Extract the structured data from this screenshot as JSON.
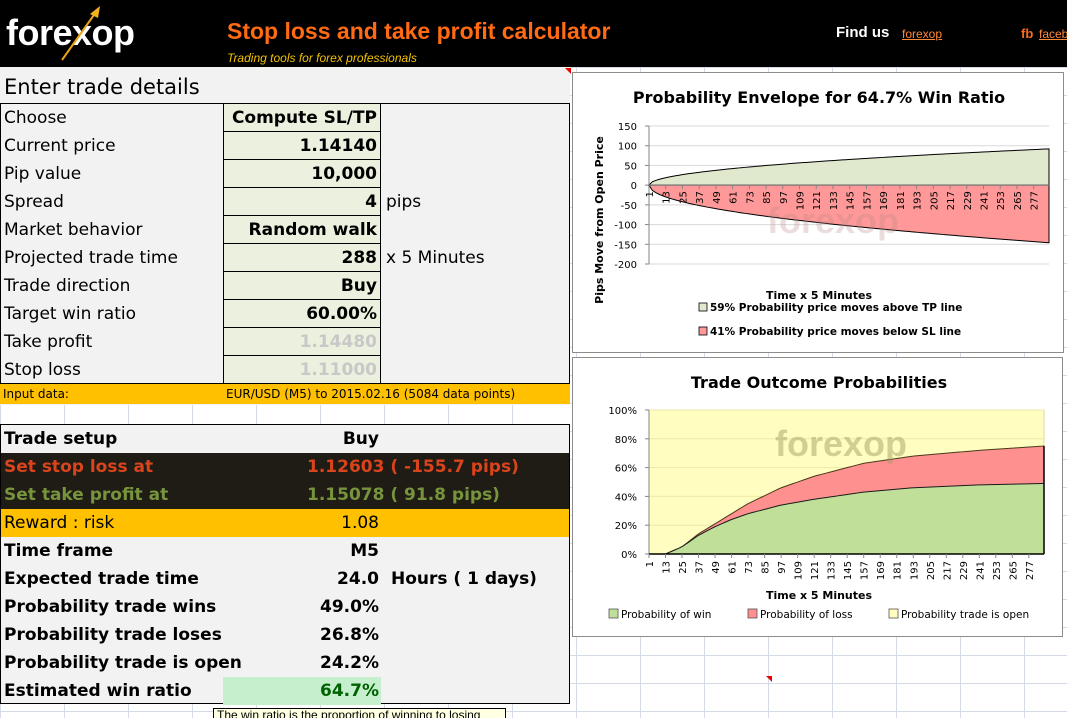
{
  "header": {
    "logo": "forexop",
    "title": "Stop loss and take profit calculator",
    "subtitle": "Trading tools for forex professionals",
    "find_us_label": "Find us",
    "find_us_link": "forexop",
    "fb_label": "fb",
    "fb_link": "facebook"
  },
  "inputs": {
    "section_title": "Enter trade details",
    "rows": [
      {
        "label": "Choose",
        "value": "Compute SL/TP",
        "unit": ""
      },
      {
        "label": "Current price",
        "value": "1.14140",
        "unit": ""
      },
      {
        "label": "Pip value",
        "value": "10,000",
        "unit": ""
      },
      {
        "label": "Spread",
        "value": "4",
        "unit": "pips"
      },
      {
        "label": "Market behavior",
        "value": "Random walk",
        "unit": ""
      },
      {
        "label": "Projected trade time",
        "value": "288",
        "unit": "x 5 Minutes"
      },
      {
        "label": "Trade direction",
        "value": "Buy",
        "unit": ""
      },
      {
        "label": "Target win ratio",
        "value": "60.00%",
        "unit": ""
      },
      {
        "label": "Take profit",
        "value": "1.14480",
        "unit": "",
        "disabled": true
      },
      {
        "label": "Stop loss",
        "value": "1.11000",
        "unit": "",
        "disabled": true
      }
    ],
    "input_data_label": "Input data:",
    "input_data_value": "EUR/USD (M5) to 2015.02.16  (5084 data points)"
  },
  "results": {
    "trade_setup": {
      "label": "Trade setup",
      "value": "Buy"
    },
    "stop_loss": {
      "label": "Set stop loss at",
      "value": "1.12603 ( -155.7 pips)"
    },
    "take_profit": {
      "label": "Set take profit at",
      "value": "1.15078 ( 91.8 pips)"
    },
    "reward_risk": {
      "label": "Reward : risk",
      "value": "1.08"
    },
    "time_frame": {
      "label": "Time frame",
      "value": "M5"
    },
    "expected_time": {
      "label": "Expected trade time",
      "value": "24.0",
      "unit": "Hours ( 1 days)"
    },
    "prob_win": {
      "label": "Probability trade wins",
      "value": "49.0%"
    },
    "prob_lose": {
      "label": "Probability trade loses",
      "value": "26.8%"
    },
    "prob_open": {
      "label": "Probability trade is open",
      "value": "24.2%"
    },
    "win_ratio": {
      "label": "Estimated win ratio",
      "value": "64.7%"
    }
  },
  "tooltip": "The win ratio is the proportion of winning to losing",
  "colors": {
    "brand_orange": "#ff6a13",
    "input_fill": "#ebf1de",
    "gold": "#ffc000",
    "dark_row": "#1f1c16",
    "sl_red": "#d9441c",
    "tp_green": "#77933c",
    "win_fill": "#c6efce",
    "win_text": "#006100"
  },
  "chart_data": [
    {
      "type": "area",
      "title": "Probability Envelope for 64.7% Win Ratio",
      "xlabel": "Time x 5 Minutes",
      "ylabel": "Pips Move from Open Price",
      "ylim": [
        -200,
        150
      ],
      "yticks": [
        150,
        100,
        50,
        0,
        -50,
        -100,
        -150,
        -200
      ],
      "x_range": [
        1,
        288
      ],
      "xtick_labels": [
        "1",
        "13",
        "25",
        "37",
        "49",
        "61",
        "73",
        "85",
        "97",
        "109",
        "121",
        "133",
        "145",
        "157",
        "169",
        "181",
        "193",
        "205",
        "217",
        "229",
        "241",
        "253",
        "265",
        "277"
      ],
      "grid": true,
      "legend_position": "bottom",
      "watermark": "forexop",
      "series": [
        {
          "name": "59% Probability price moves above TP line",
          "color": "#e0e9cd",
          "x": [
            1,
            13,
            25,
            49,
            97,
            145,
            193,
            241,
            288
          ],
          "values": [
            0,
            19,
            27,
            38,
            54,
            65,
            75,
            84,
            92
          ]
        },
        {
          "name": "41% Probability price moves below SL line",
          "color": "#ff9999",
          "x": [
            1,
            13,
            25,
            49,
            97,
            145,
            193,
            241,
            288
          ],
          "values": [
            0,
            -31,
            -44,
            -61,
            -87,
            -106,
            -122,
            -134,
            -146
          ]
        }
      ]
    },
    {
      "type": "area",
      "title": "Trade Outcome Probabilities",
      "xlabel": "Time x 5 Minutes",
      "ylabel": "",
      "ylim": [
        0,
        100
      ],
      "yticks": [
        "100%",
        "80%",
        "60%",
        "40%",
        "20%",
        "0%"
      ],
      "x_range": [
        1,
        288
      ],
      "xtick_labels": [
        "1",
        "13",
        "25",
        "37",
        "49",
        "61",
        "73",
        "85",
        "97",
        "109",
        "121",
        "133",
        "145",
        "157",
        "169",
        "181",
        "193",
        "205",
        "217",
        "229",
        "241",
        "253",
        "265",
        "277"
      ],
      "grid": true,
      "stacked": true,
      "legend_position": "bottom",
      "watermark": "forexop",
      "series": [
        {
          "name": "Probability of win",
          "color": "#c0e09a",
          "x": [
            1,
            13,
            25,
            37,
            49,
            61,
            73,
            97,
            121,
            157,
            193,
            241,
            288
          ],
          "values": [
            0,
            0,
            5,
            13,
            19,
            24,
            28,
            34,
            38,
            43,
            46,
            48,
            49
          ]
        },
        {
          "name": "Probability of loss",
          "color": "#ff9090",
          "x": [
            1,
            13,
            25,
            37,
            49,
            61,
            73,
            97,
            121,
            157,
            193,
            241,
            288
          ],
          "values": [
            0,
            0,
            0,
            1,
            2,
            4,
            7,
            12,
            16,
            20,
            22,
            24,
            26
          ]
        },
        {
          "name": "Probability trade is open",
          "color": "#fffdbf",
          "x": [
            1,
            13,
            25,
            37,
            49,
            61,
            73,
            97,
            121,
            157,
            193,
            241,
            288
          ],
          "values": [
            100,
            100,
            95,
            86,
            79,
            72,
            65,
            54,
            46,
            37,
            32,
            28,
            25
          ]
        }
      ]
    }
  ]
}
